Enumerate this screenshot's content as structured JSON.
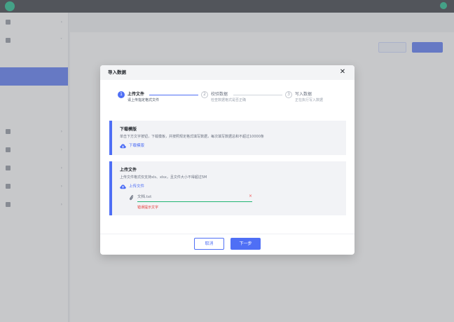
{
  "app": {
    "title": "",
    "top_right": [
      "",
      ""
    ],
    "breadcrumb": "",
    "page_heading": ""
  },
  "sidebar": {
    "items": [
      "",
      "",
      "",
      "",
      "",
      "",
      "",
      "",
      "",
      "",
      ""
    ],
    "active_index": 3
  },
  "modal": {
    "title": "导入数据",
    "close_icon": "close-icon",
    "steps": [
      {
        "number": "1",
        "title": "上传文件",
        "desc": "请上传指定格式文件",
        "state": "active"
      },
      {
        "number": "2",
        "title": "校验数据",
        "desc": "检查数据格式是否正确",
        "state": "pending"
      },
      {
        "number": "3",
        "title": "写入数据",
        "desc": "正在执行写入数据",
        "state": "pending"
      }
    ],
    "download_section": {
      "title": "下载模版",
      "desc": "单击下方文字按钮，下载模板，并按照规定格式填写数据，每次填写数据总和不超过10000条",
      "link_label": "下载模版",
      "icon": "cloud-download-icon"
    },
    "upload_section": {
      "title": "上传文件",
      "desc": "上传文件格式仅支持xls、xlsx，且文件大小不得超过5M",
      "link_label": "上传文件",
      "icon": "cloud-upload-icon",
      "file_name": "文档.txt",
      "remove_label": "×",
      "error_message": "错误提示文字"
    },
    "buttons": {
      "cancel": "取消",
      "next": "下一步"
    }
  },
  "colors": {
    "primary": "#4f6ff5",
    "success": "#22b573",
    "error": "#e53935",
    "topbar": "#2b2f36",
    "brand": "#12b886"
  }
}
